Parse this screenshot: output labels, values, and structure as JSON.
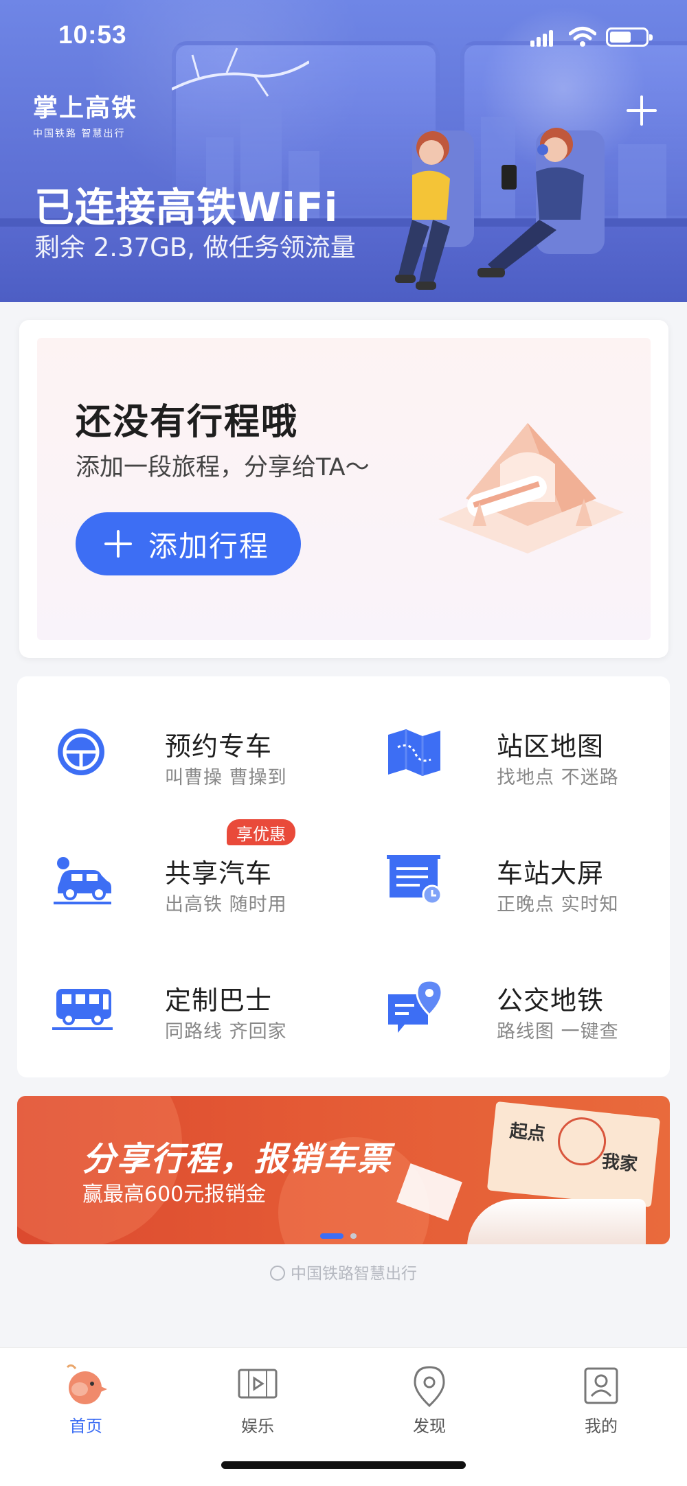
{
  "status_bar": {
    "time": "10:53"
  },
  "hero": {
    "logo_main": "掌上高铁",
    "logo_sub": "中国铁路 智慧出行",
    "title": "已连接高铁WiFi",
    "subtitle": "剩余 2.37GB, 做任务领流量",
    "add_icon": "plus-icon"
  },
  "trip": {
    "title": "还没有行程哦",
    "subtitle": "添加一段旅程，分享给TA～",
    "add_button": "添加行程"
  },
  "services": [
    {
      "title": "预约专车",
      "subtitle": "叫曹操 曹操到",
      "icon": "steering-wheel-icon"
    },
    {
      "title": "站区地图",
      "subtitle": "找地点 不迷路",
      "icon": "map-icon"
    },
    {
      "title": "共享汽车",
      "subtitle": "出高铁 随时用",
      "icon": "car-icon",
      "badge": "享优惠"
    },
    {
      "title": "车站大屏",
      "subtitle": "正晚点 实时知",
      "icon": "schedule-board-icon"
    },
    {
      "title": "定制巴士",
      "subtitle": "同路线 齐回家",
      "icon": "bus-icon"
    },
    {
      "title": "公交地铁",
      "subtitle": "路线图 一键查",
      "icon": "transit-map-icon"
    }
  ],
  "banner": {
    "title": "分享行程，报销车票",
    "subtitle": "赢最高600元报销金",
    "ticket_from": "起点",
    "ticket_to": "我家",
    "page_index": 1,
    "page_count": 2
  },
  "footer": {
    "text": "中国铁路智慧出行"
  },
  "tabs": [
    {
      "label": "首页",
      "icon": "home-mascot-icon",
      "active": true
    },
    {
      "label": "娱乐",
      "icon": "video-play-icon",
      "active": false
    },
    {
      "label": "发现",
      "icon": "location-pin-icon",
      "active": false
    },
    {
      "label": "我的",
      "icon": "profile-card-icon",
      "active": false
    }
  ],
  "colors": {
    "accent": "#3d6ef4",
    "badge": "#e94a3a",
    "banner": "#dc4a2f"
  }
}
